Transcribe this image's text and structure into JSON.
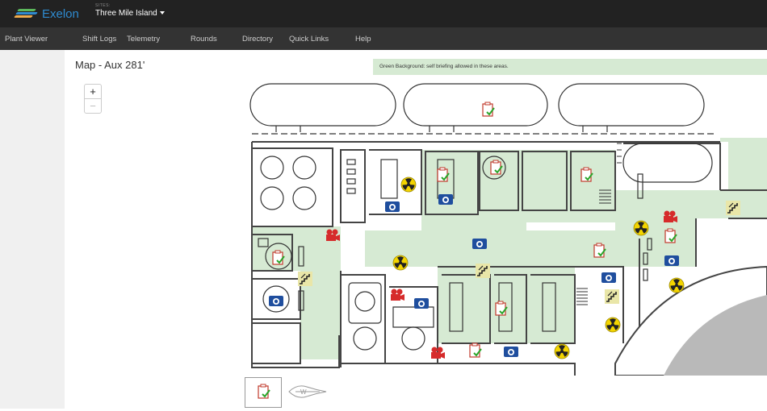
{
  "header": {
    "brand": "Exelon",
    "site_label": "SITES:",
    "site_value": "Three Mile Island"
  },
  "nav": {
    "items": [
      "Plant Viewer",
      "Shift Logs",
      "Telemetry",
      "Rounds",
      "Directory",
      "Quick Links",
      "Help"
    ]
  },
  "page": {
    "title": "Map - Aux 281'",
    "legend_note": "Green Background: self briefing allowed in these areas."
  },
  "zoom": {
    "in_label": "+",
    "out_label": "−"
  },
  "colors": {
    "topbar": "#222222",
    "navbar": "#333333",
    "brand": "#2f8bd0",
    "green_area": "#d6ead3",
    "camera": "#1f4e9e",
    "video": "#d62b2b",
    "radiation": "#f3d400",
    "clipboard_check": "#2aa52a"
  },
  "map_icons": {
    "clipboard": "clipboard-check-icon",
    "camera": "camera-icon",
    "video": "video-camera-icon",
    "radiation": "radiation-icon",
    "stairs": "stairs-icon"
  }
}
